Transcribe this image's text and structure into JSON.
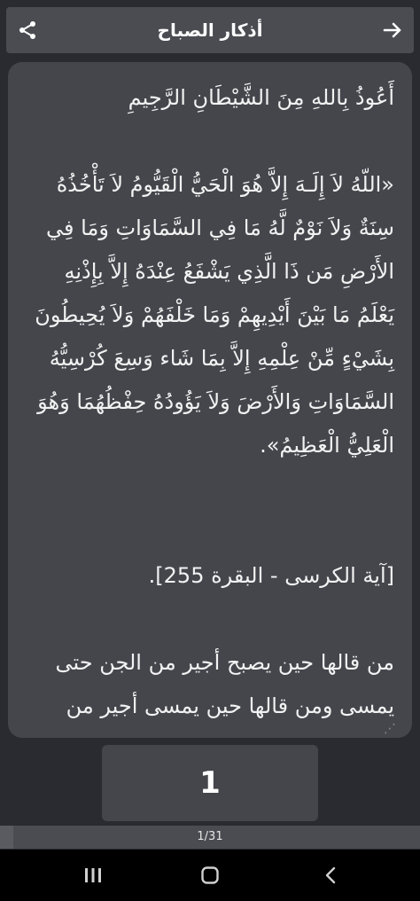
{
  "header": {
    "title": "أذكار الصباح",
    "share_icon": "share-icon",
    "forward_icon": "arrow-right-icon"
  },
  "dhikr": {
    "intro": "أَعُوذُ بِاللهِ مِنَ الشَّيْطَانِ الرَّجِيمِ",
    "verse": "«اللّهُ لاَ إِلَـهَ إِلاَّ هُوَ الْحَيُّ الْقَيُّومُ لاَ تَأْخُذُهُ سِنَةٌ وَلاَ نَوْمٌ لَّهُ مَا فِي السَّمَاوَاتِ وَمَا فِي الأَرْضِ مَن ذَا الَّذِي يَشْفَعُ عِنْدَهُ إِلاَّ بِإِذْنِهِ يَعْلَمُ مَا بَيْنَ أَيْدِيهِمْ وَمَا خَلْفَهُمْ وَلاَ يُحِيطُونَ بِشَيْءٍ مِّنْ عِلْمِهِ إِلاَّ بِمَا شَاء وَسِعَ كُرْسِيُّهُ السَّمَاوَاتِ وَالأَرْضَ وَلاَ يَؤُودُهُ حِفْظُهُمَا وَهُوَ الْعَلِيُّ الْعَظِيمُ».",
    "reference": "[آية الكرسى - البقرة 255].",
    "virtue": "من قالها حين يصبح أجير من الجن حتى يمسى ومن قالها حين يمسى أجير من"
  },
  "counter": {
    "value": "1"
  },
  "progress": {
    "label": "1/31",
    "fraction": 0.032
  },
  "navbar": {
    "recents_icon": "recents-icon",
    "home_icon": "home-icon",
    "back_icon": "back-chevron-icon"
  }
}
